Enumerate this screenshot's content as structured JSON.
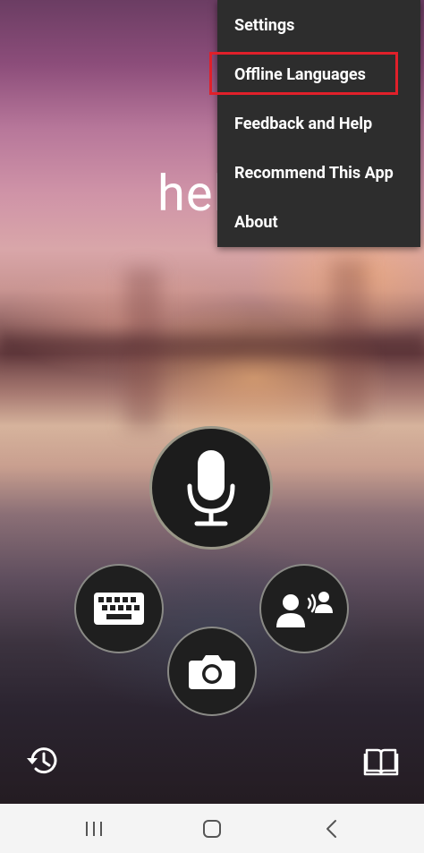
{
  "background_text": "hel",
  "menu": {
    "items": [
      {
        "label": "Settings"
      },
      {
        "label": "Offline Languages",
        "highlighted": true
      },
      {
        "label": "Feedback and Help"
      },
      {
        "label": "Recommend This App"
      },
      {
        "label": "About"
      }
    ],
    "highlight_color": "#e0202a"
  },
  "actions": {
    "microphone": "microphone-icon",
    "keyboard": "keyboard-icon",
    "camera": "camera-icon",
    "conversation": "conversation-icon"
  },
  "bottom_toolbar": {
    "history": "history-icon",
    "phrasebook": "phrasebook-icon"
  },
  "navbar": {
    "recent": "recent-apps-icon",
    "home": "home-icon",
    "back": "back-icon"
  }
}
